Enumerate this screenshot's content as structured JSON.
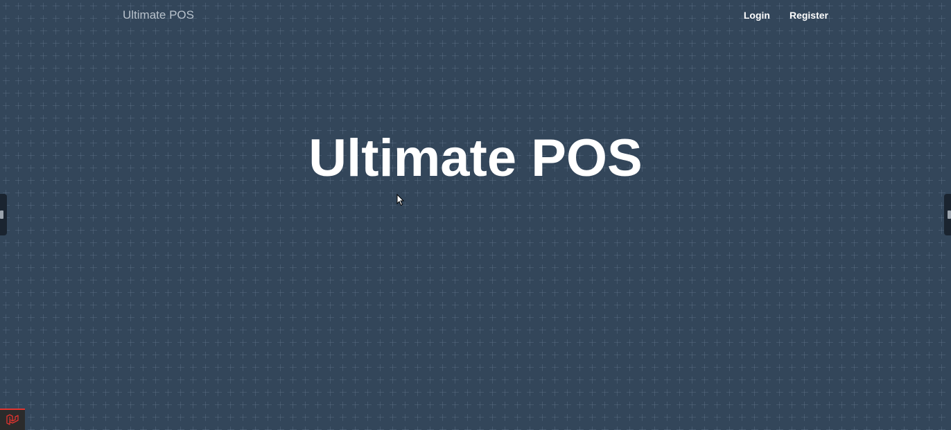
{
  "navbar": {
    "brand": "Ultimate POS",
    "links": [
      {
        "label": "Login"
      },
      {
        "label": "Register"
      }
    ]
  },
  "hero": {
    "title": "Ultimate POS"
  },
  "icons": {
    "cursor": "mouse-pointer-icon",
    "debugbar": "laravel-logo-icon",
    "side_handles": "drag-handle-icon"
  },
  "colors": {
    "background": "#243447",
    "title": "#ffffff",
    "brand": "#b8c2cc",
    "debug_accent": "#e3342f"
  }
}
